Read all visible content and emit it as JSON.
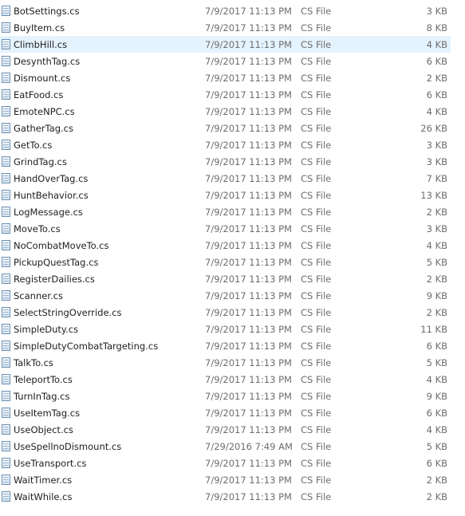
{
  "files": [
    {
      "name": "BotSettings.cs",
      "date": "7/9/2017 11:13 PM",
      "type": "CS File",
      "size": "3 KB"
    },
    {
      "name": "BuyItem.cs",
      "date": "7/9/2017 11:13 PM",
      "type": "CS File",
      "size": "8 KB"
    },
    {
      "name": "ClimbHill.cs",
      "date": "7/9/2017 11:13 PM",
      "type": "CS File",
      "size": "4 KB",
      "selected": true
    },
    {
      "name": "DesynthTag.cs",
      "date": "7/9/2017 11:13 PM",
      "type": "CS File",
      "size": "6 KB"
    },
    {
      "name": "Dismount.cs",
      "date": "7/9/2017 11:13 PM",
      "type": "CS File",
      "size": "2 KB"
    },
    {
      "name": "EatFood.cs",
      "date": "7/9/2017 11:13 PM",
      "type": "CS File",
      "size": "6 KB"
    },
    {
      "name": "EmoteNPC.cs",
      "date": "7/9/2017 11:13 PM",
      "type": "CS File",
      "size": "4 KB"
    },
    {
      "name": "GatherTag.cs",
      "date": "7/9/2017 11:13 PM",
      "type": "CS File",
      "size": "26 KB"
    },
    {
      "name": "GetTo.cs",
      "date": "7/9/2017 11:13 PM",
      "type": "CS File",
      "size": "3 KB"
    },
    {
      "name": "GrindTag.cs",
      "date": "7/9/2017 11:13 PM",
      "type": "CS File",
      "size": "3 KB"
    },
    {
      "name": "HandOverTag.cs",
      "date": "7/9/2017 11:13 PM",
      "type": "CS File",
      "size": "7 KB"
    },
    {
      "name": "HuntBehavior.cs",
      "date": "7/9/2017 11:13 PM",
      "type": "CS File",
      "size": "13 KB"
    },
    {
      "name": "LogMessage.cs",
      "date": "7/9/2017 11:13 PM",
      "type": "CS File",
      "size": "2 KB"
    },
    {
      "name": "MoveTo.cs",
      "date": "7/9/2017 11:13 PM",
      "type": "CS File",
      "size": "3 KB"
    },
    {
      "name": "NoCombatMoveTo.cs",
      "date": "7/9/2017 11:13 PM",
      "type": "CS File",
      "size": "4 KB"
    },
    {
      "name": "PickupQuestTag.cs",
      "date": "7/9/2017 11:13 PM",
      "type": "CS File",
      "size": "5 KB"
    },
    {
      "name": "RegisterDailies.cs",
      "date": "7/9/2017 11:13 PM",
      "type": "CS File",
      "size": "2 KB"
    },
    {
      "name": "Scanner.cs",
      "date": "7/9/2017 11:13 PM",
      "type": "CS File",
      "size": "9 KB"
    },
    {
      "name": "SelectStringOverride.cs",
      "date": "7/9/2017 11:13 PM",
      "type": "CS File",
      "size": "2 KB"
    },
    {
      "name": "SimpleDuty.cs",
      "date": "7/9/2017 11:13 PM",
      "type": "CS File",
      "size": "11 KB"
    },
    {
      "name": "SimpleDutyCombatTargeting.cs",
      "date": "7/9/2017 11:13 PM",
      "type": "CS File",
      "size": "6 KB"
    },
    {
      "name": "TalkTo.cs",
      "date": "7/9/2017 11:13 PM",
      "type": "CS File",
      "size": "5 KB"
    },
    {
      "name": "TeleportTo.cs",
      "date": "7/9/2017 11:13 PM",
      "type": "CS File",
      "size": "4 KB"
    },
    {
      "name": "TurnInTag.cs",
      "date": "7/9/2017 11:13 PM",
      "type": "CS File",
      "size": "9 KB"
    },
    {
      "name": "UseItemTag.cs",
      "date": "7/9/2017 11:13 PM",
      "type": "CS File",
      "size": "6 KB"
    },
    {
      "name": "UseObject.cs",
      "date": "7/9/2017 11:13 PM",
      "type": "CS File",
      "size": "4 KB"
    },
    {
      "name": "UseSpellnoDismount.cs",
      "date": "7/29/2016 7:49 AM",
      "type": "CS File",
      "size": "5 KB"
    },
    {
      "name": "UseTransport.cs",
      "date": "7/9/2017 11:13 PM",
      "type": "CS File",
      "size": "6 KB"
    },
    {
      "name": "WaitTimer.cs",
      "date": "7/9/2017 11:13 PM",
      "type": "CS File",
      "size": "2 KB"
    },
    {
      "name": "WaitWhile.cs",
      "date": "7/9/2017 11:13 PM",
      "type": "CS File",
      "size": "2 KB"
    }
  ],
  "colors": {
    "selected_row": "#e5f3ff",
    "secondary_text": "#6d6d6d",
    "primary_text": "#1e1e1e"
  },
  "icons": {
    "file": "cs-file-icon"
  }
}
